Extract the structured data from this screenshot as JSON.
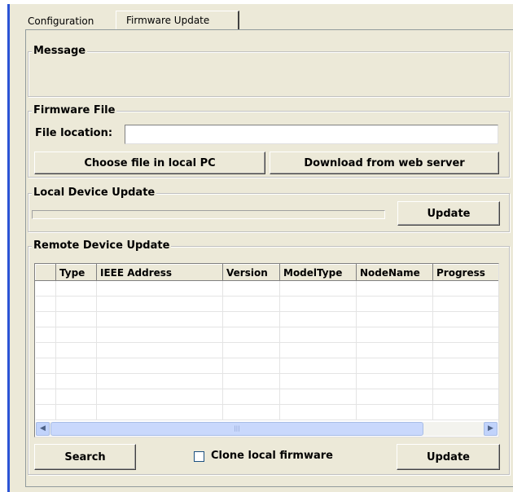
{
  "tabs": [
    {
      "label": "Configuration",
      "active": false
    },
    {
      "label": "Firmware Update",
      "active": true
    }
  ],
  "message": {
    "legend": "Message",
    "text": ""
  },
  "firmware_file": {
    "legend": "Firmware File",
    "location_label": "File location:",
    "location_value": "",
    "choose_local_label": "Choose file in local PC",
    "download_web_label": "Download from web server"
  },
  "local_update": {
    "legend": "Local Device Update",
    "progress": 0,
    "update_label": "Update"
  },
  "remote_update": {
    "legend": "Remote Device Update",
    "columns": [
      "",
      "Type",
      "IEEE Address",
      "Version",
      "ModelType",
      "NodeName",
      "Progress"
    ],
    "rows": [],
    "search_label": "Search",
    "clone_label": "Clone local firmware",
    "clone_checked": false,
    "update_label": "Update"
  },
  "colors": {
    "face": "#ece9d8",
    "accent_border": "#2b54d6",
    "scrollbar": "#c1d3fb"
  }
}
